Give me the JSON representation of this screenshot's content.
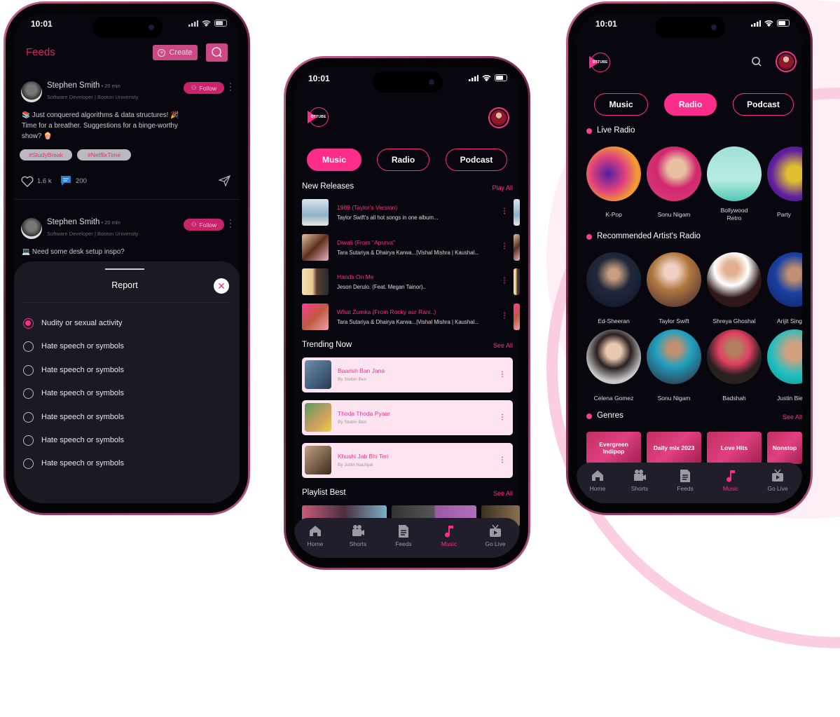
{
  "colors": {
    "accent": "#ff2d8a",
    "background": "#08070f",
    "nav": "#1f1e2a",
    "card": "#fde4f0"
  },
  "feeds_screen": {
    "status_time": "10:01",
    "title": "Feeds",
    "create_label": "Create",
    "posts": [
      {
        "name": "Stephen Smith",
        "time": "20 min",
        "subtitle": "Software Developer | Boston University",
        "follow": "Follow",
        "text": "📚 Just conquered algorithms & data structures! 🎉 Time for a breather. Suggestions for a binge-worthy show? 🍿",
        "tags": [
          "#StudyBreak",
          "#NetflixTime"
        ],
        "likes": "1.6 k",
        "comments": "200"
      },
      {
        "name": "Stephen Smith",
        "time": "20 min",
        "subtitle": "Software Developer | Boston University",
        "follow": "Follow",
        "text": "💻 Need some desk setup inspo?"
      }
    ],
    "report_sheet": {
      "title": "Report",
      "options": [
        {
          "label": "Nudity or sexual activity",
          "selected": true
        },
        {
          "label": "Hate speech or symbols",
          "selected": false
        },
        {
          "label": "Hate speech or symbols",
          "selected": false
        },
        {
          "label": "Hate speech or symbols",
          "selected": false
        },
        {
          "label": "Hate speech or symbols",
          "selected": false
        },
        {
          "label": "Hate speech or symbols",
          "selected": false
        },
        {
          "label": "Hate speech or symbols",
          "selected": false
        }
      ]
    }
  },
  "music_screen": {
    "status_time": "10:01",
    "logo_text": "DTTUBE",
    "tabs": [
      {
        "label": "Music",
        "active": true
      },
      {
        "label": "Radio",
        "active": false
      },
      {
        "label": "Podcast",
        "active": false
      }
    ],
    "new_releases": {
      "title": "New Releases",
      "action": "Play All",
      "items": [
        {
          "title": "1989 (Taylor's Version)",
          "subtitle": "Taylor Swift's all hot songs in one album..."
        },
        {
          "title": "Diwali (From \"Apurva\"",
          "subtitle": "Tara Sutariya & Dhairya Karwa...|Vishal Mishra | Kaushal..."
        },
        {
          "title": "Hands On Me",
          "subtitle": "Jeson Derulo. (Feat. Megan Tainor).."
        },
        {
          "title": "What Zumka (From Rocky aur Rani..)",
          "subtitle": "Tara Sutariya & Dhairya Karwa...|Vishal Mishra | Kaushal..."
        }
      ]
    },
    "trending": {
      "title": "Trending Now",
      "action": "See All",
      "items": [
        {
          "title": "Baarish Ban Jana",
          "artist": "By Stebin Ben"
        },
        {
          "title": "Thoda Thoda Pyaar",
          "artist": "By Stebin Ben"
        },
        {
          "title": "Khushi Jab Bhi Teri",
          "artist": "By Jubin Nautiyal"
        }
      ]
    },
    "playlist": {
      "title": "Playlist Best",
      "action": "See All"
    }
  },
  "radio_screen": {
    "status_time": "10:01",
    "logo_text": "DTTUBE",
    "tabs": [
      {
        "label": "Music",
        "active": false
      },
      {
        "label": "Radio",
        "active": true
      },
      {
        "label": "Podcast",
        "active": false
      }
    ],
    "live_radio": {
      "title": "Live Radio",
      "items": [
        "K-Pop",
        "Sonu Nigam",
        "Bollywood Retro",
        "Party"
      ]
    },
    "recommended": {
      "title": "Recommended Artist's Radio",
      "items": [
        "Ed-Sheeran",
        "Taylor Swift",
        "Shreya Ghoshal",
        "Arijit Singh",
        "Celena Gomez",
        "Sonu Nigam",
        "Badshah",
        "Justin Bieber"
      ]
    },
    "genres": {
      "title": "Genres",
      "action": "See All",
      "items": [
        "Evergreen Indipop",
        "Daily mix 2023",
        "Love Hits",
        "Nonstop"
      ]
    }
  },
  "bottom_nav": [
    {
      "label": "Home",
      "icon": "home-icon"
    },
    {
      "label": "Shorts",
      "icon": "video-camera-icon"
    },
    {
      "label": "Feeds",
      "icon": "document-icon"
    },
    {
      "label": "Music",
      "icon": "music-note-icon",
      "active": true
    },
    {
      "label": "Go Live",
      "icon": "tv-icon"
    }
  ]
}
